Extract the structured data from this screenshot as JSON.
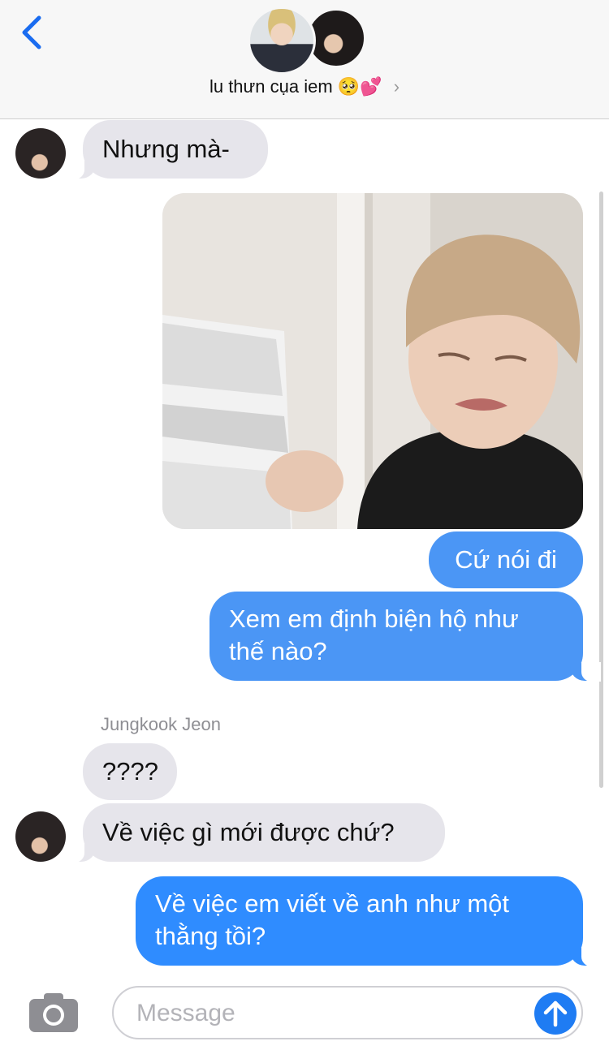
{
  "header": {
    "title": "lu thưn cụa iem",
    "title_emojis": "🥺💕",
    "chevron": "›",
    "back_icon": "chevron-left-icon"
  },
  "messages": [
    {
      "direction": "incoming",
      "text": "Nhưng mà-"
    },
    {
      "direction": "outgoing",
      "type": "photo",
      "description": "meme-photo"
    },
    {
      "direction": "outgoing",
      "text": "Cứ nói đi"
    },
    {
      "direction": "outgoing",
      "line1": "Xem em định biện hộ như",
      "line2": "thế nào?"
    },
    {
      "direction": "incoming",
      "sender": "Jungkook Jeon",
      "text": "????"
    },
    {
      "direction": "incoming",
      "text": "Về việc gì mới được chứ?"
    },
    {
      "direction": "outgoing",
      "line1": "Về việc em viết về anh như một",
      "line2": "thằng tồi?"
    }
  ],
  "composer": {
    "placeholder": "Message",
    "camera_icon": "camera-icon",
    "send_icon": "arrow-up-icon"
  },
  "colors": {
    "outgoing_bubble": "#2f8cff",
    "incoming_bubble": "#e6e5eb",
    "accent": "#1f7cf3"
  }
}
